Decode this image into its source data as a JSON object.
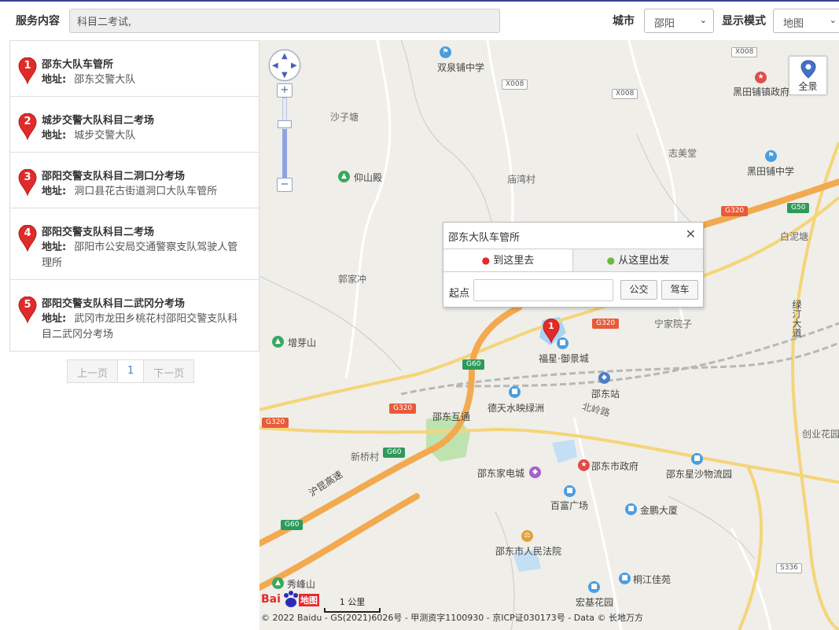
{
  "header": {
    "service_label": "服务内容",
    "search_value": "科目二考试,",
    "city_label": "城市",
    "city_value": "邵阳",
    "mode_label": "显示模式",
    "mode_value": "地图"
  },
  "results": [
    {
      "index": "1",
      "title": "邵东大队车管所",
      "addr_key": "地址:",
      "address": "邵东交警大队"
    },
    {
      "index": "2",
      "title": "城步交警大队科目二考场",
      "addr_key": "地址:",
      "address": "城步交警大队"
    },
    {
      "index": "3",
      "title": "邵阳交警支队科目二洞口分考场",
      "addr_key": "地址:",
      "address": "洞口县花古街道洞口大队车管所"
    },
    {
      "index": "4",
      "title": "邵阳交警支队科目二考场",
      "addr_key": "地址:",
      "address": "邵阳市公安局交通警察支队驾驶人管理所"
    },
    {
      "index": "5",
      "title": "邵阳交警支队科目二武冈分考场",
      "addr_key": "地址:",
      "address": "武冈市龙田乡桃花村邵阳交警支队科目二武冈分考场"
    }
  ],
  "pager": {
    "prev": "上一页",
    "current": "1",
    "next": "下一页"
  },
  "map": {
    "pano_label": "全景",
    "zoom_in": "+",
    "zoom_out": "−",
    "marker_index": "1",
    "popup": {
      "title": "邵东大队车管所",
      "close": "✕",
      "tab_to": "到这里去",
      "tab_from": "从这里出发",
      "start_label": "起点",
      "bus_button": "公交",
      "drive_button": "驾车"
    },
    "labels": {
      "shuangquan": "双泉铺中学",
      "heitian_gov": "黑田铺镇政府",
      "shazitang": "沙子塘",
      "zhimeitang": "志美堂",
      "heitian_school": "黑田铺中学",
      "yangshandian": "仰山殿",
      "miaowan": "庙湾村",
      "bainitang": "白泥塘",
      "guojiachong": "郭家冲",
      "ningjiayuan": "宁家院子",
      "lvting": "绿汀大道",
      "zengyashan": "增芽山",
      "fuxing": "福星·御景城",
      "shaodong_station": "邵东站",
      "detian": "德天水映绿洲",
      "beiling": "北岭路",
      "shaodong_hutong": "邵东互通",
      "xinqiao": "新桥村",
      "shaodong_gov": "邵东市政府",
      "shaodong_appliance": "邵东家电城",
      "logistics": "邵东星沙物流园",
      "chuangye": "创业花园",
      "hukun": "沪昆高速",
      "baifu": "百富广场",
      "jinpeng": "金鹏大厦",
      "court": "邵东市人民法院",
      "xiufeng": "秀峰山",
      "tongjiang": "桐江佳苑",
      "hongji": "宏基花园"
    },
    "road_shields": {
      "x008a": "X008",
      "x008b": "X008",
      "x008c": "X008",
      "g320a": "G320",
      "g50": "G50",
      "g320b": "G320",
      "g60a": "G60",
      "g320c": "G320",
      "g320d": "G320",
      "g60b": "G60",
      "g60c": "G60",
      "s336": "S336"
    },
    "scale_label": "1 公里",
    "logo_bai": "Bai",
    "logo_map": "地图",
    "copyright": "© 2022 Baidu - GS(2021)6026号 - 甲测资字1100930 - 京ICP证030173号 - Data © 长地万方"
  },
  "colors": {
    "pin_red": "#e02b2b",
    "highway_orange": "#f3a94f",
    "water_blue": "#a9d3f5",
    "park_green": "#bfe3b0",
    "accent_blue": "#4461b8"
  }
}
